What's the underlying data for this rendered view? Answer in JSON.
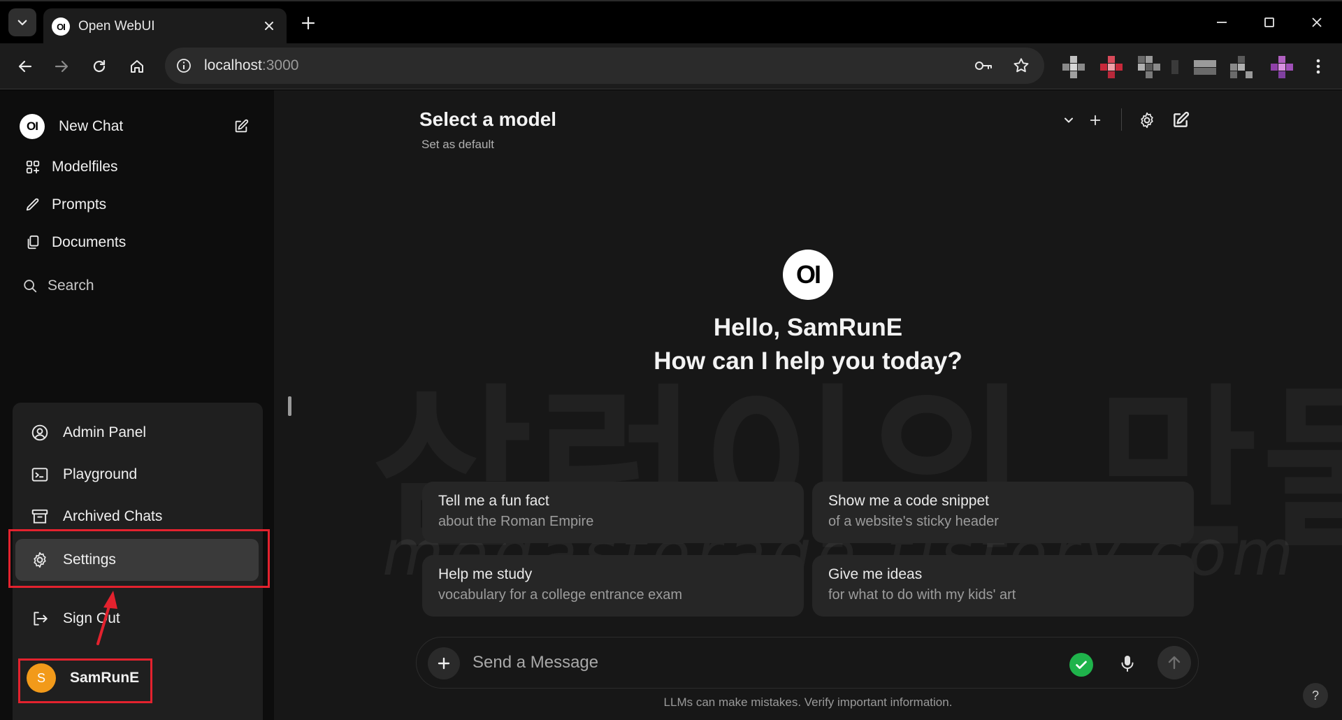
{
  "browser": {
    "tab_title": "Open WebUI",
    "url_host": "localhost",
    "url_port": ":3000"
  },
  "sidebar": {
    "new_chat": "New Chat",
    "nav": [
      {
        "label": "Modelfiles",
        "icon": "modelfiles-icon"
      },
      {
        "label": "Prompts",
        "icon": "pencil-icon"
      },
      {
        "label": "Documents",
        "icon": "documents-icon"
      }
    ],
    "search": "Search",
    "menu": {
      "admin_panel": "Admin Panel",
      "playground": "Playground",
      "archived_chats": "Archived Chats",
      "settings": "Settings",
      "sign_out": "Sign Out"
    },
    "user": {
      "initial": "S",
      "name": "SamRunE"
    }
  },
  "header": {
    "model_title": "Select a model",
    "set_default": "Set as default"
  },
  "welcome": {
    "logo": "OI",
    "greeting": "Hello, SamRunE",
    "prompt": "How can I help you today?"
  },
  "watermark": {
    "korean": "삼런이의 만물상",
    "url": "megastorage.tistory.com"
  },
  "suggestions": [
    {
      "title": "Tell me a fun fact",
      "subtitle": "about the Roman Empire"
    },
    {
      "title": "Show me a code snippet",
      "subtitle": "of a website's sticky header"
    },
    {
      "title": "Help me study",
      "subtitle": "vocabulary for a college entrance exam"
    },
    {
      "title": "Give me ideas",
      "subtitle": "for what to do with my kids' art"
    }
  ],
  "composer": {
    "placeholder": "Send a Message"
  },
  "disclaimer": "LLMs can make mistakes. Verify important information.",
  "help": "?",
  "colors": {
    "annotation_red": "#e3222e",
    "avatar_orange": "#f29a1a",
    "grammar_green": "#1fb34b"
  }
}
